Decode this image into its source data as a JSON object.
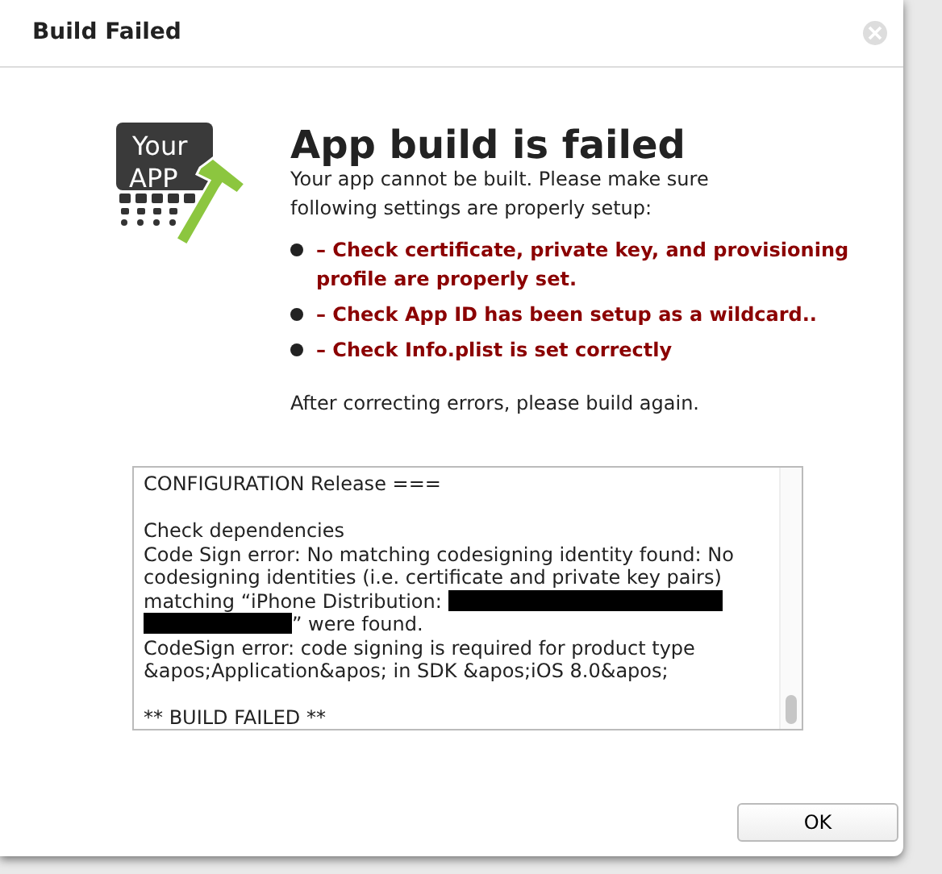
{
  "window": {
    "title": "Build Failed"
  },
  "logo": {
    "line_1": "Your",
    "line_2": "APP"
  },
  "heading": "App build is failed",
  "intro": "Your app cannot be built. Please make sure following settings are properly setup:",
  "checks": [
    "– Check certificate, private key, and provisioning profile are properly set.",
    "– Check App ID has been setup as a wildcard..",
    "– Check Info.plist is set correctly"
  ],
  "outro": "After correcting errors, please build again.",
  "log": [
    {
      "kind": "text",
      "text": "CONFIGURATION Release ==="
    },
    {
      "kind": "blank"
    },
    {
      "kind": "text",
      "text": "Check dependencies"
    },
    {
      "kind": "text",
      "text": "Code Sign error: No matching codesigning identity found: No codesigning identities (i.e. certificate and private key pairs)"
    },
    {
      "kind": "redacted",
      "before": "matching “iPhone Distribution:",
      "after": "” were found."
    },
    {
      "kind": "text",
      "text": "CodeSign error: code signing is required for product type &apos;Application&apos; in SDK &apos;iOS 8.0&apos;"
    },
    {
      "kind": "blank"
    },
    {
      "kind": "text",
      "text": "** BUILD FAILED **"
    }
  ],
  "buttons": [
    "OK"
  ]
}
